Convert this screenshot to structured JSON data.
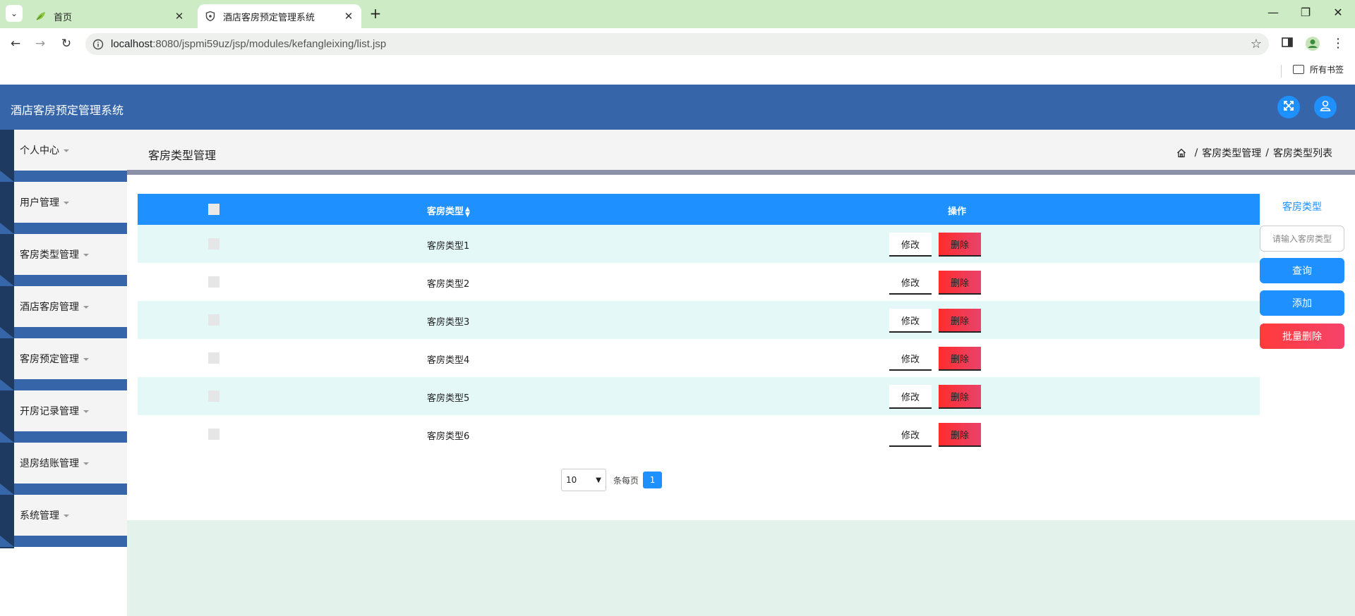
{
  "browser": {
    "tabs": [
      {
        "title": "首页",
        "favicon": "leaf-icon"
      },
      {
        "title": "酒店客房预定管理系统",
        "favicon": "shield-icon"
      }
    ],
    "url_host": "localhost",
    "url_path": ":8080/jspmi59uz/jsp/modules/kefangleixing/list.jsp",
    "bookmarks_label": "所有书签"
  },
  "app": {
    "title": "酒店客房预定管理系统"
  },
  "sidebar": {
    "items": [
      {
        "label": "个人中心"
      },
      {
        "label": "用户管理"
      },
      {
        "label": "客房类型管理"
      },
      {
        "label": "酒店客房管理"
      },
      {
        "label": "客房预定管理"
      },
      {
        "label": "开房记录管理"
      },
      {
        "label": "退房结账管理"
      },
      {
        "label": "系统管理"
      }
    ]
  },
  "page": {
    "title": "客房类型管理",
    "breadcrumb": [
      "客房类型管理",
      "客房类型列表"
    ]
  },
  "table": {
    "headers": {
      "type": "客房类型",
      "op": "操作"
    },
    "rows": [
      {
        "type": "客房类型1"
      },
      {
        "type": "客房类型2"
      },
      {
        "type": "客房类型3"
      },
      {
        "type": "客房类型4"
      },
      {
        "type": "客房类型5"
      },
      {
        "type": "客房类型6"
      }
    ],
    "edit_label": "修改",
    "delete_label": "删除"
  },
  "pagination": {
    "page_size": "10",
    "per_page_label": "条每页",
    "current_page": "1"
  },
  "search": {
    "label": "客房类型",
    "placeholder": "请输入客房类型",
    "query_label": "查询",
    "add_label": "添加",
    "batch_delete_label": "批量删除"
  },
  "colors": {
    "header": "#3666a9",
    "primary": "#1e90ff",
    "danger": "#ff3b3b",
    "row_alt": "#e4f8f8"
  }
}
